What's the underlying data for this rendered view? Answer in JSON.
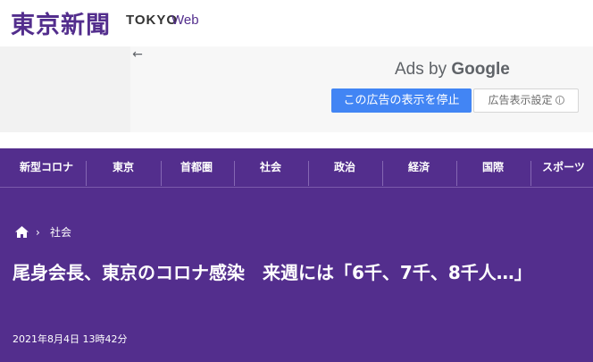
{
  "header": {
    "logo_jp": "東京新聞",
    "logo_tokyo": "TOKYO",
    "logo_web": "Web"
  },
  "ad": {
    "back_icon": "arrow-left-icon",
    "ads_by_prefix": "Ads by",
    "ads_by_brand": "Google",
    "stop_label": "この広告の表示を停止",
    "settings_label": "広告表示設定",
    "info_icon": "info-icon",
    "stop_color": "#4285f4"
  },
  "nav": {
    "items": [
      {
        "label": "新型コロナ"
      },
      {
        "label": "東京"
      },
      {
        "label": "首都圏"
      },
      {
        "label": "社会"
      },
      {
        "label": "政治"
      },
      {
        "label": "経済"
      },
      {
        "label": "国際"
      },
      {
        "label": "スポーツ"
      }
    ]
  },
  "breadcrumb": {
    "home_icon": "home-icon",
    "separator": "›",
    "section": "社会"
  },
  "article": {
    "headline": "尾身会長、東京のコロナ感染　来週には「6千、7千、8千人…」",
    "date": "2021年8月4日 13時42分"
  },
  "colors": {
    "brand_purple": "#532e8d",
    "ad_blue": "#4285f4"
  }
}
